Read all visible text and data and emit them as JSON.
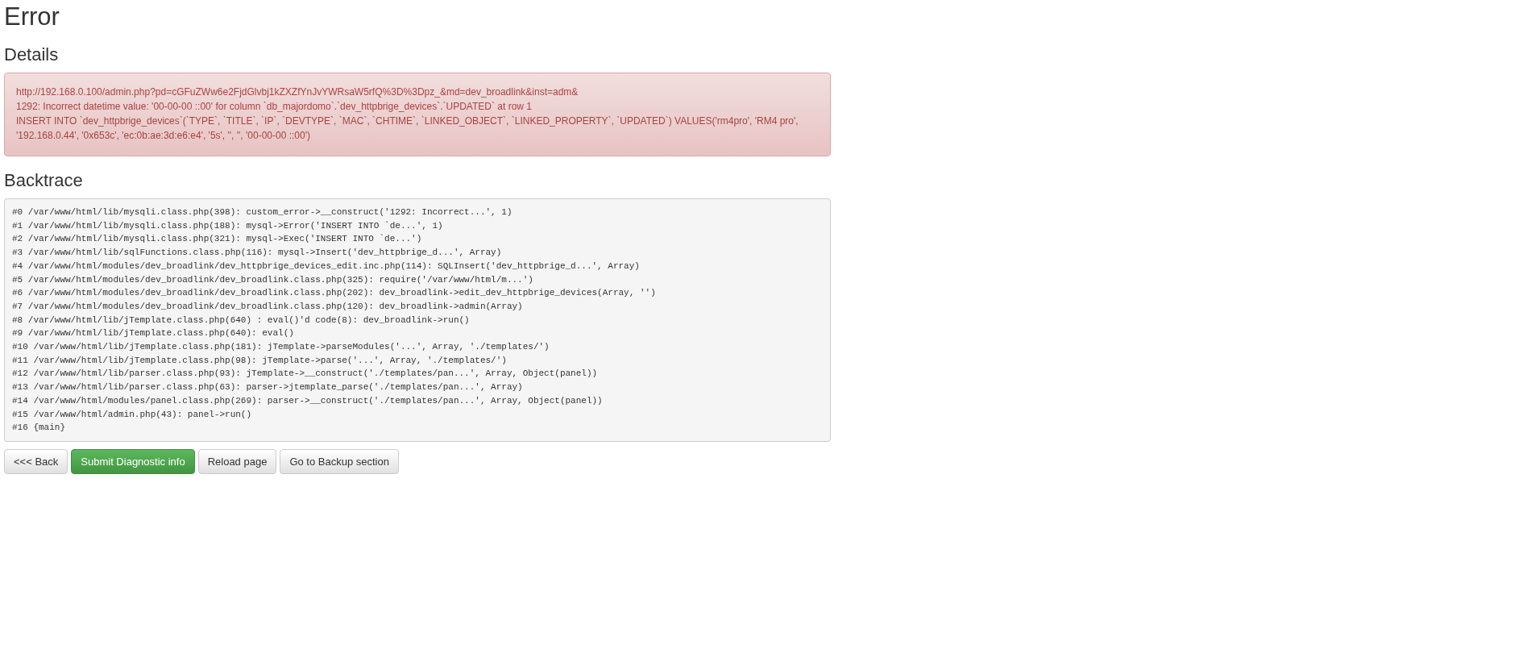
{
  "title": "Error",
  "details": {
    "heading": "Details",
    "lines": [
      "http://192.168.0.100/admin.php?pd=cGFuZWw6e2FjdGlvbj1kZXZfYnJvYWRsaW5rfQ%3D%3Dpz_&md=dev_broadlink&inst=adm&",
      "1292: Incorrect datetime value: '00-00-00 ::00' for column `db_majordomo`.`dev_httpbrige_devices`.`UPDATED` at row 1",
      "INSERT INTO `dev_httpbrige_devices`(`TYPE`, `TITLE`, `IP`, `DEVTYPE`, `MAC`, `CHTIME`, `LINKED_OBJECT`, `LINKED_PROPERTY`, `UPDATED`) VALUES('rm4pro', 'RM4 pro', '192.168.0.44', '0x653c', 'ec:0b:ae:3d:e6:e4', '5s', '', '', '00-00-00 ::00')"
    ]
  },
  "backtrace": {
    "heading": "Backtrace",
    "lines": [
      "#0 /var/www/html/lib/mysqli.class.php(398): custom_error->__construct('1292: Incorrect...', 1)",
      "#1 /var/www/html/lib/mysqli.class.php(188): mysql->Error('INSERT INTO `de...', 1)",
      "#2 /var/www/html/lib/mysqli.class.php(321): mysql->Exec('INSERT INTO `de...')",
      "#3 /var/www/html/lib/sqlFunctions.class.php(116): mysql->Insert('dev_httpbrige_d...', Array)",
      "#4 /var/www/html/modules/dev_broadlink/dev_httpbrige_devices_edit.inc.php(114): SQLInsert('dev_httpbrige_d...', Array)",
      "#5 /var/www/html/modules/dev_broadlink/dev_broadlink.class.php(325): require('/var/www/html/m...')",
      "#6 /var/www/html/modules/dev_broadlink/dev_broadlink.class.php(202): dev_broadlink->edit_dev_httpbrige_devices(Array, '')",
      "#7 /var/www/html/modules/dev_broadlink/dev_broadlink.class.php(120): dev_broadlink->admin(Array)",
      "#8 /var/www/html/lib/jTemplate.class.php(640) : eval()'d code(8): dev_broadlink->run()",
      "#9 /var/www/html/lib/jTemplate.class.php(640): eval()",
      "#10 /var/www/html/lib/jTemplate.class.php(181): jTemplate->parseModules('...', Array, './templates/')",
      "#11 /var/www/html/lib/jTemplate.class.php(98): jTemplate->parse('...', Array, './templates/')",
      "#12 /var/www/html/lib/parser.class.php(93): jTemplate->__construct('./templates/pan...', Array, Object(panel))",
      "#13 /var/www/html/lib/parser.class.php(63): parser->jtemplate_parse('./templates/pan...', Array)",
      "#14 /var/www/html/modules/panel.class.php(269): parser->__construct('./templates/pan...', Array, Object(panel))",
      "#15 /var/www/html/admin.php(43): panel->run()",
      "#16 {main}"
    ]
  },
  "buttons": [
    {
      "label": "<<< Back",
      "kind": "default"
    },
    {
      "label": "Submit Diagnostic info",
      "kind": "success"
    },
    {
      "label": "Reload page",
      "kind": "default"
    },
    {
      "label": "Go to Backup section",
      "kind": "default"
    }
  ]
}
